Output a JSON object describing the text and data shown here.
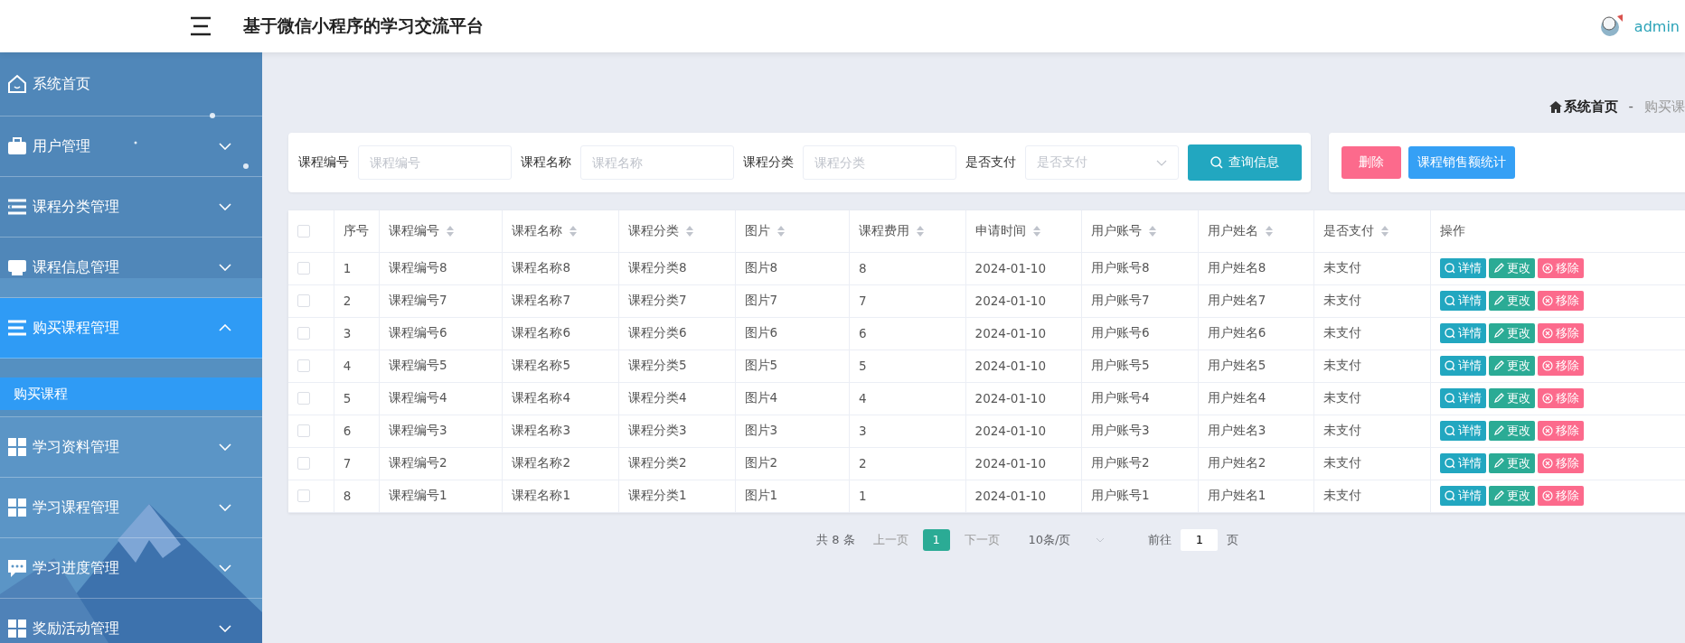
{
  "header": {
    "title": "基于微信小程序的学习交流平台",
    "user": "admin"
  },
  "sidebar": {
    "items": [
      {
        "label": "系统首页",
        "kind": "link",
        "selected": false
      },
      {
        "label": "用户管理",
        "kind": "group",
        "selected": false,
        "expanded": false
      },
      {
        "label": "课程分类管理",
        "kind": "group",
        "selected": false,
        "expanded": false
      },
      {
        "label": "课程信息管理",
        "kind": "group",
        "selected": false,
        "expanded": false
      },
      {
        "label": "购买课程管理",
        "kind": "group",
        "selected": true,
        "expanded": true,
        "children": [
          {
            "label": "购买课程",
            "selected": true
          }
        ]
      },
      {
        "label": "学习资料管理",
        "kind": "group",
        "selected": false,
        "expanded": false
      },
      {
        "label": "学习课程管理",
        "kind": "group",
        "selected": false,
        "expanded": false
      },
      {
        "label": "学习进度管理",
        "kind": "group",
        "selected": false,
        "expanded": false
      },
      {
        "label": "奖励活动管理",
        "kind": "group",
        "selected": false,
        "expanded": false
      }
    ]
  },
  "breadcrumb": {
    "items": [
      "系统首页",
      "购买课"
    ],
    "separator": "-"
  },
  "search": {
    "fields": [
      {
        "label": "课程编号",
        "placeholder": "课程编号",
        "kind": "input"
      },
      {
        "label": "课程名称",
        "placeholder": "课程名称",
        "kind": "input"
      },
      {
        "label": "课程分类",
        "placeholder": "课程分类",
        "kind": "input"
      },
      {
        "label": "是否支付",
        "placeholder": "是否支付",
        "kind": "select"
      }
    ],
    "button": "查询信息"
  },
  "actions": [
    {
      "label": "删除",
      "kind": "danger"
    },
    {
      "label": "课程销售额统计",
      "kind": "primary"
    }
  ],
  "table": {
    "select_all_checked": false,
    "columns": [
      {
        "label": "序号",
        "sortable": false
      },
      {
        "label": "课程编号",
        "sortable": true
      },
      {
        "label": "课程名称",
        "sortable": true
      },
      {
        "label": "课程分类",
        "sortable": true
      },
      {
        "label": "图片",
        "sortable": true
      },
      {
        "label": "课程费用",
        "sortable": true
      },
      {
        "label": "申请时间",
        "sortable": true
      },
      {
        "label": "用户账号",
        "sortable": true
      },
      {
        "label": "用户姓名",
        "sortable": true
      },
      {
        "label": "是否支付",
        "sortable": true
      },
      {
        "label": "操作",
        "sortable": false
      }
    ],
    "rows": [
      {
        "checked": false,
        "cells": [
          "1",
          "课程编号8",
          "课程名称8",
          "课程分类8",
          "图片8",
          "8",
          "2024-01-10",
          "用户账号8",
          "用户姓名8",
          "未支付"
        ],
        "actions": [
          "详情",
          "更改",
          "移除"
        ]
      },
      {
        "checked": false,
        "cells": [
          "2",
          "课程编号7",
          "课程名称7",
          "课程分类7",
          "图片7",
          "7",
          "2024-01-10",
          "用户账号7",
          "用户姓名7",
          "未支付"
        ],
        "actions": [
          "详情",
          "更改",
          "移除"
        ]
      },
      {
        "checked": false,
        "cells": [
          "3",
          "课程编号6",
          "课程名称6",
          "课程分类6",
          "图片6",
          "6",
          "2024-01-10",
          "用户账号6",
          "用户姓名6",
          "未支付"
        ],
        "actions": [
          "详情",
          "更改",
          "移除"
        ]
      },
      {
        "checked": false,
        "cells": [
          "4",
          "课程编号5",
          "课程名称5",
          "课程分类5",
          "图片5",
          "5",
          "2024-01-10",
          "用户账号5",
          "用户姓名5",
          "未支付"
        ],
        "actions": [
          "详情",
          "更改",
          "移除"
        ]
      },
      {
        "checked": false,
        "cells": [
          "5",
          "课程编号4",
          "课程名称4",
          "课程分类4",
          "图片4",
          "4",
          "2024-01-10",
          "用户账号4",
          "用户姓名4",
          "未支付"
        ],
        "actions": [
          "详情",
          "更改",
          "移除"
        ]
      },
      {
        "checked": false,
        "cells": [
          "6",
          "课程编号3",
          "课程名称3",
          "课程分类3",
          "图片3",
          "3",
          "2024-01-10",
          "用户账号3",
          "用户姓名3",
          "未支付"
        ],
        "actions": [
          "详情",
          "更改",
          "移除"
        ]
      },
      {
        "checked": false,
        "cells": [
          "7",
          "课程编号2",
          "课程名称2",
          "课程分类2",
          "图片2",
          "2",
          "2024-01-10",
          "用户账号2",
          "用户姓名2",
          "未支付"
        ],
        "actions": [
          "详情",
          "更改",
          "移除"
        ]
      },
      {
        "checked": false,
        "cells": [
          "8",
          "课程编号1",
          "课程名称1",
          "课程分类1",
          "图片1",
          "1",
          "2024-01-10",
          "用户账号1",
          "用户姓名1",
          "未支付"
        ],
        "actions": [
          "详情",
          "更改",
          "移除"
        ]
      }
    ]
  },
  "pagination": {
    "total": "共 8 条",
    "prev": "上一页",
    "pages": [
      {
        "label": "1",
        "selected": true
      }
    ],
    "next": "下一页",
    "page_size": "10条/页",
    "goto_label": "前往",
    "goto_value": "1",
    "goto_suffix": "页"
  }
}
